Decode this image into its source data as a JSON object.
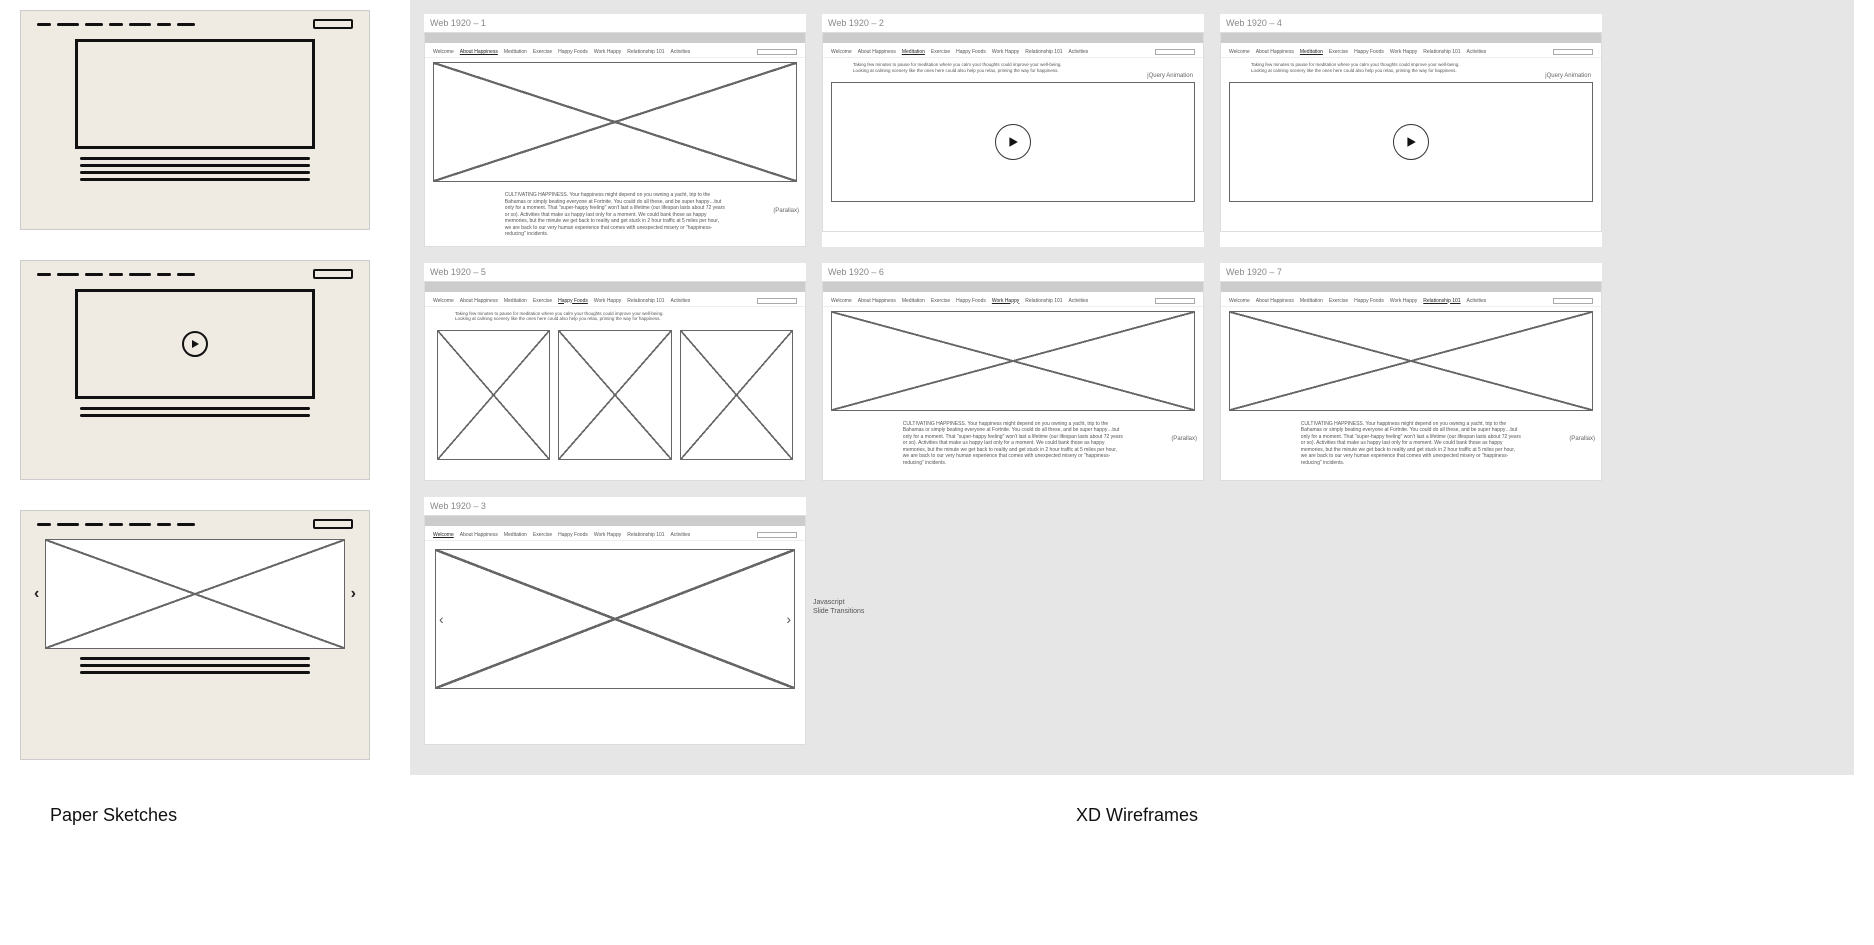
{
  "captions": {
    "left": "Paper Sketches",
    "right": "XD Wireframes"
  },
  "nav_items": [
    "Welcome",
    "About Happiness",
    "Meditation",
    "Exercise",
    "Happy Foods",
    "Work Happy",
    "Relationship 101",
    "Activities"
  ],
  "paragraph_cultivate": "CULTIVATING HAPPINESS. Your happiness might depend on you owning a yacht, trip to the Bahamas or simply beating everyone at Fortnite. You could do all these, and be super happy…but only for a moment. That \"super-happy feeling\" won't last a lifetime (our lifespan lasts about 72 years or so). Activities that make us happy last only for a moment. We could bank those as happy memories, but the minute we get back to reality and get stuck in 2 hour traffic at 5 miles per hour, we are back to our very human experience that comes with unexpected misery or \"happiness-reducing\" incidents.",
  "paragraph_meditation": "Taking few minutes to pause for meditation where you calm your thoughts could improve your well-being. Looking at calming scenery like the ones here could also help you relax, priming the way for happiness.",
  "labels": {
    "parallax": "(Parallax)",
    "jquery": "jQuery Animation",
    "js_slide": "Javascript\nSlide Transitions"
  },
  "artboards": {
    "a1": {
      "title": "Web 1920 – 1",
      "active_nav": "About Happiness"
    },
    "a2": {
      "title": "Web 1920 – 2",
      "active_nav": "Meditation"
    },
    "a4": {
      "title": "Web 1920 – 4",
      "active_nav": "Meditation"
    },
    "a5": {
      "title": "Web 1920 – 5",
      "active_nav": "Happy Foods"
    },
    "a6": {
      "title": "Web 1920 – 6",
      "active_nav": "Work Happy"
    },
    "a7": {
      "title": "Web 1920 – 7",
      "active_nav": "Relationship 101"
    },
    "a3": {
      "title": "Web 1920 – 3",
      "active_nav": "Welcome"
    }
  }
}
